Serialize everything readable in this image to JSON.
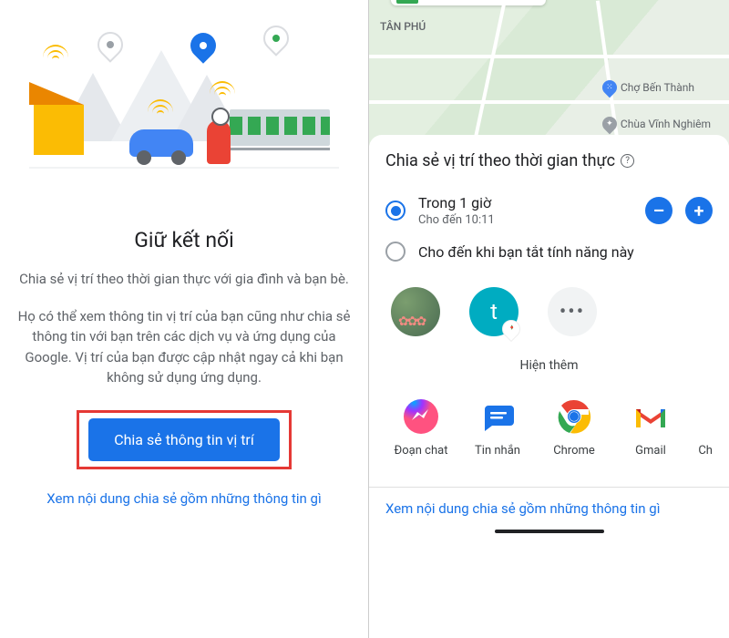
{
  "left": {
    "title": "Giữ kết nối",
    "desc1": "Chia sẻ vị trí theo thời gian thực với gia đình và bạn bè.",
    "desc2": "Họ có thể xem thông tin vị trí của bạn cũng như chia sẻ thông tin với bạn trên các dịch vụ và ứng dụng của Google. Vị trí của bạn được cập nhật ngay cả khi bạn không sử dụng ứng dụng.",
    "primary_button": "Chia sẻ thông tin vị trí",
    "link": "Xem nội dung chia sẻ gồm những thông tin gì"
  },
  "right": {
    "map": {
      "district_label": "TÂN PHÚ",
      "poi1": "Chợ Bến Thành",
      "poi2": "Chùa Vĩnh Nghiêm"
    },
    "sheet_title": "Chia sẻ vị trí theo thời gian thực",
    "help_icon": "?",
    "options": [
      {
        "label": "Trong 1 giờ",
        "sub": "Cho đến 10:11",
        "selected": true
      },
      {
        "label": "Cho đến khi bạn tắt tính năng này",
        "sub": "",
        "selected": false
      }
    ],
    "minus": "–",
    "plus": "+",
    "contacts": {
      "t_letter": "t",
      "more_dots": "•••",
      "more_label": "Hiện thêm"
    },
    "apps": [
      {
        "name": "Đoạn chat"
      },
      {
        "name": "Tin nhắn"
      },
      {
        "name": "Chrome"
      },
      {
        "name": "Gmail"
      },
      {
        "name": "Chia sẻ lân cận"
      }
    ],
    "footer_link": "Xem nội dung chia sẻ gồm những thông tin gì"
  }
}
